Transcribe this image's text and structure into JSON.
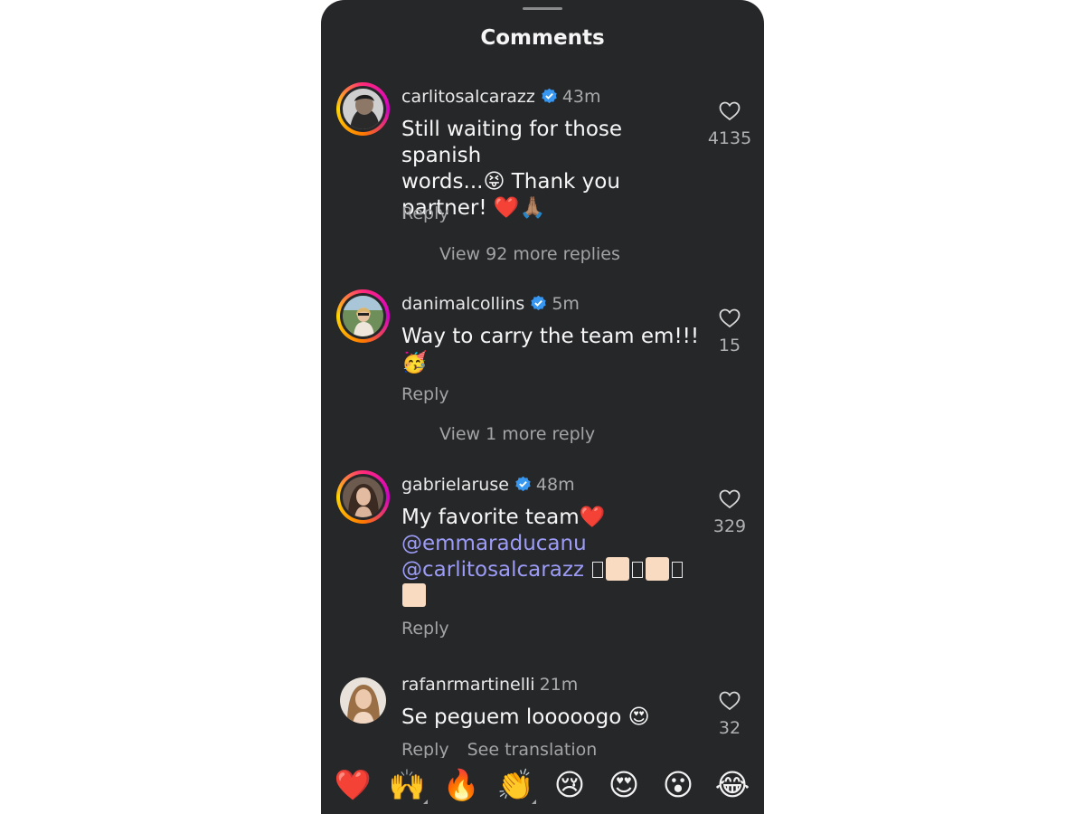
{
  "header": {
    "title": "Comments"
  },
  "comments": [
    {
      "username": "carlitosalcarazz",
      "verified": true,
      "time": "43m",
      "text_lines": [
        "Still waiting for those spanish",
        "words...😝 Thank you",
        "partner! ❤️🙏🏽"
      ],
      "reply_label": "Reply",
      "view_more": "View 92 more replies",
      "likes": "4135"
    },
    {
      "username": "danimalcollins",
      "verified": true,
      "time": "5m",
      "text_lines": [
        "Way to carry the team em!!!",
        "🥳"
      ],
      "reply_label": "Reply",
      "view_more": "View 1 more reply",
      "likes": "15"
    },
    {
      "username": "gabrielaruse",
      "verified": true,
      "time": "48m",
      "text_line1": "My favorite team❤️",
      "mention1": "@emmaraducanu",
      "mention2": "@carlitosalcarazz",
      "reply_label": "Reply",
      "likes": "329"
    },
    {
      "username": "rafanrmartinelli",
      "verified": false,
      "time": "21m",
      "text": "Se peguem looooogo 😍",
      "reply_label": "Reply",
      "translate_label": "See translation",
      "likes": "32"
    }
  ],
  "emoji_bar": [
    "❤️",
    "🙌",
    "🔥",
    "👏",
    "😢",
    "😍",
    "😮",
    "😂"
  ],
  "colors": {
    "background": "#262729",
    "mention": "#9c9cf7",
    "verified": "#3897f0",
    "secondary_text": "#a3a4a6"
  }
}
